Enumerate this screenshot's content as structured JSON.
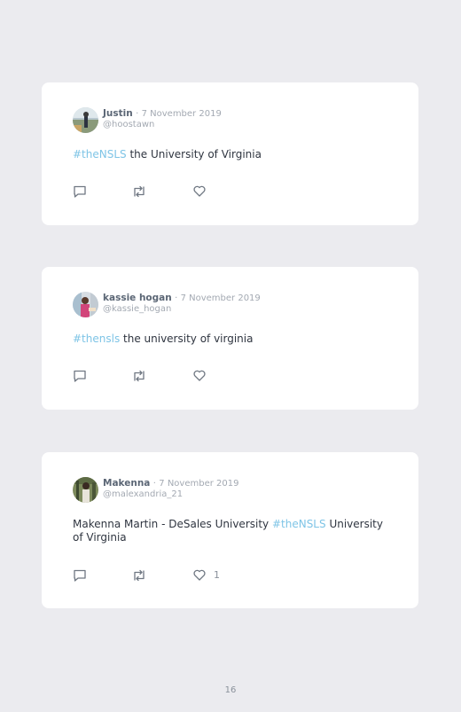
{
  "tweets": [
    {
      "name": "Justin",
      "separator": "·",
      "date": "7 November 2019",
      "handle": "@hoostawn",
      "hashtag": "#theNSLS",
      "text_before": "",
      "text_after": " the University of Virginia",
      "likes": ""
    },
    {
      "name": "kassie hogan",
      "separator": "·",
      "date": "7 November 2019",
      "handle": "@kassie_hogan",
      "hashtag": "#thensls",
      "text_before": "",
      "text_after": " the university of virginia",
      "likes": ""
    },
    {
      "name": "Makenna",
      "separator": "·",
      "date": "7 November 2019",
      "handle": "@malexandria_21",
      "hashtag": "#theNSLS",
      "text_before": "Makenna Martin - DeSales University ",
      "text_after": " University of Virginia",
      "likes": "1"
    }
  ],
  "icons": {
    "reply": "reply-icon",
    "retweet": "retweet-icon",
    "like": "like-icon"
  },
  "colors": {
    "background": "#ebebef",
    "hashtag": "#7ec4e6",
    "name": "#5b6675",
    "muted": "#a3a9b2"
  },
  "page_number": "16"
}
